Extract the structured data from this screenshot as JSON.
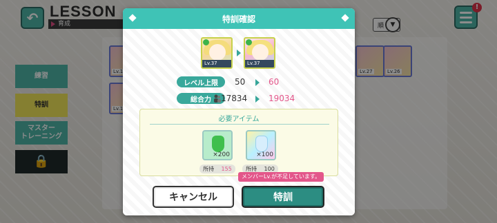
{
  "background": {
    "header_title": "LESSON",
    "header_sub": "育成",
    "sort_label": "順",
    "notification_badge": "!",
    "sidebar": [
      "練習",
      "特訓",
      "マスター\nトレーニング",
      ""
    ],
    "cards": [
      {
        "lv": "Lv.1"
      },
      {
        "lv": "Lv.1"
      },
      {
        "lv": "Lv.27"
      },
      {
        "lv": "Lv.26"
      }
    ],
    "icons": {
      "back": "back-arrow-icon",
      "menu": "hamburger-menu-icon",
      "lock": "lock-icon"
    }
  },
  "dialog": {
    "title": "特訓確認",
    "before_card": {
      "lv": "Lv.37"
    },
    "after_card": {
      "lv": "Lv.37"
    },
    "stats": [
      {
        "label": "レベル上限",
        "old": "50",
        "new": "60"
      },
      {
        "label": "総合力",
        "old": "17834",
        "new": "19034"
      }
    ],
    "required_items": {
      "title": "必要アイテム",
      "items": [
        {
          "icon": "green-potion-icon",
          "count": "×200",
          "owned_label": "所持",
          "owned": "155"
        },
        {
          "icon": "rainbow-potion-icon",
          "count": "×100",
          "owned_label": "所持",
          "owned": "100"
        }
      ]
    },
    "warning": "メンバーLv.が不足しています。",
    "cancel_button": "キャンセル",
    "confirm_button": "特訓"
  },
  "colors": {
    "accent": "#3fc3b6",
    "highlight": "#e3568a",
    "confirm": "#2c8d82"
  }
}
